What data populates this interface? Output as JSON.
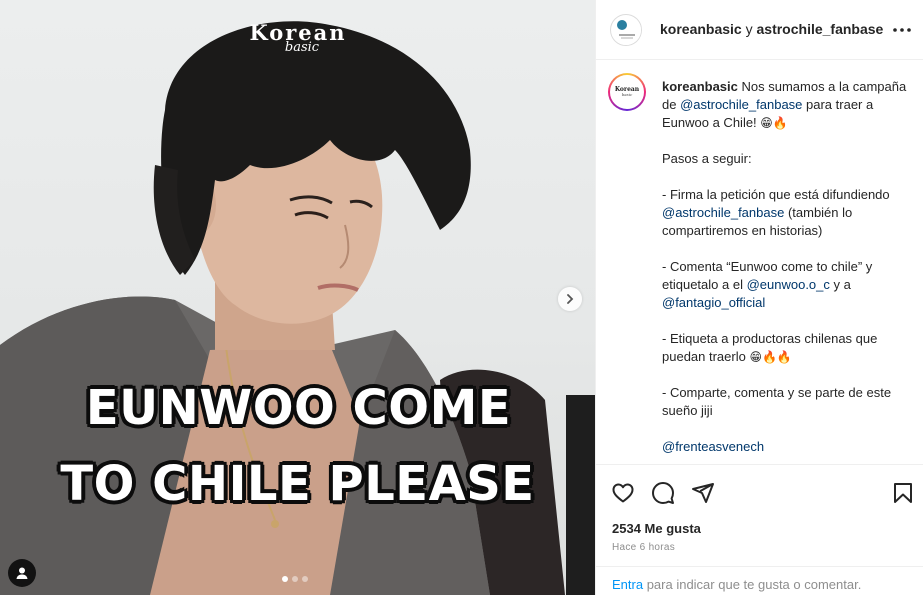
{
  "media": {
    "brand_word": "Korean",
    "brand_script": "basic",
    "caption_line1": "EUNWOO COME",
    "caption_line2": "TO CHILE PLEASE",
    "carousel_count": 3,
    "carousel_active": 1
  },
  "header": {
    "user1": "koreanbasic",
    "conjunction": "y",
    "user2": "astrochile_fanbase"
  },
  "post": {
    "username": "koreanbasic",
    "p1_a": " Nos sumamos a la campaña de ",
    "p1_mention": "@astrochile_fanbase",
    "p1_b": " para traer a Eunwoo a Chile! ",
    "p1_emoji": "😁🔥",
    "p2": "Pasos a seguir:",
    "p3_a": "- Firma la petición que está difundiendo ",
    "p3_mention": "@astrochile_fanbase",
    "p3_b": " (también lo compartiremos en historias)",
    "p4_a": "- Comenta “Eunwoo come to chile” y etiquetalo a el ",
    "p4_mention1": "@eunwoo.o_c",
    "p4_b": " y a ",
    "p4_mention2": "@fantagio_official",
    "p5_a": "- Etiqueta a productoras chilenas que puedan traerlo ",
    "p5_emoji": "😁🔥🔥",
    "p6": "- Comparte, comenta y se parte de este sueño jiji",
    "p7_mention": "@frenteasvenech"
  },
  "stats": {
    "likes": "2534 Me gusta",
    "time": "Hace 6 horas"
  },
  "comment_bar": {
    "login": "Entra",
    "rest": " para indicar que te gusta o comentar."
  },
  "colors": {
    "mention": "#00376b",
    "link": "#0095f6",
    "muted": "#8e8e8e",
    "text": "#262626"
  },
  "icons": {
    "like": "heart-icon",
    "comment": "comment-bubble-icon",
    "share": "paper-plane-icon",
    "save": "bookmark-icon",
    "more": "more-horizontal-icon",
    "next": "chevron-right-icon",
    "tags": "user-tag-icon"
  }
}
